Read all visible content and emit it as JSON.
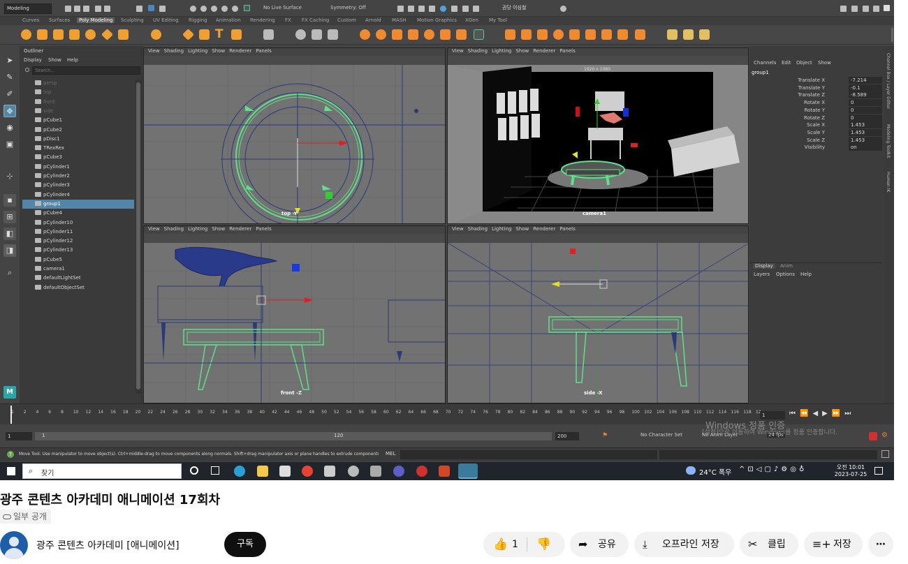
{
  "maya": {
    "menu_set": "Modeling",
    "live_surface": "No Live Surface",
    "symmetry": "Symmetry: Off",
    "user_label": "권당 이심철",
    "shelf_tabs": [
      "Curves",
      "Surfaces",
      "Poly Modeling",
      "Sculpting",
      "UV Editing",
      "Rigging",
      "Animation",
      "Rendering",
      "FX",
      "FX Caching",
      "Custom",
      "Arnold",
      "MASH",
      "Motion Graphics",
      "XGen",
      "My Tool"
    ],
    "active_shelf_tab": "Poly Modeling",
    "outliner": {
      "title": "Outliner",
      "menus": [
        "Display",
        "Show",
        "Help"
      ],
      "search_placeholder": "Search...",
      "items": [
        "persp",
        "top",
        "front",
        "side",
        "pCube1",
        "pCube2",
        "pDisc1",
        "TRexRex",
        "pCube3",
        "pCylinder1",
        "pCylinder2",
        "pCylinder3",
        "pCylinder4",
        "group1",
        "pCube4",
        "pCylinder10",
        "pCylinder11",
        "pCylinder12",
        "pCylinder13",
        "pCube5",
        "camera1",
        "defaultLightSet",
        "defaultObjectSet"
      ],
      "selected_item": "group1"
    },
    "viewport_menus": [
      "View",
      "Shading",
      "Lighting",
      "Show",
      "Renderer",
      "Panels"
    ],
    "viewports": {
      "top": {
        "label": "top -Y"
      },
      "persp": {
        "label": "camera1",
        "resolution": "1920 x 1080"
      },
      "front": {
        "label": "front -Z"
      },
      "side": {
        "label": "side -X"
      }
    },
    "channel_box": {
      "menus": [
        "Channels",
        "Edit",
        "Object",
        "Show"
      ],
      "object": "group1",
      "attributes": [
        {
          "name": "Translate X",
          "value": "-7.214"
        },
        {
          "name": "Translate Y",
          "value": "-0.1"
        },
        {
          "name": "Translate Z",
          "value": "-8.589"
        },
        {
          "name": "Rotate X",
          "value": "0"
        },
        {
          "name": "Rotate Y",
          "value": "0"
        },
        {
          "name": "Rotate Z",
          "value": "0"
        },
        {
          "name": "Scale X",
          "value": "1.453"
        },
        {
          "name": "Scale Y",
          "value": "1.453"
        },
        {
          "name": "Scale Z",
          "value": "1.453"
        },
        {
          "name": "Visibility",
          "value": "on"
        }
      ],
      "layer_tabs": [
        "Display",
        "Anim"
      ],
      "layer_menus": [
        "Layers",
        "Options",
        "Help"
      ]
    },
    "side_tabs": [
      "Channel Box / Layer Editor",
      "Modeling Toolkit",
      "Human IK"
    ],
    "timeline_ticks": [
      "1",
      "2",
      "4",
      "6",
      "8",
      "10",
      "12",
      "14",
      "16",
      "18",
      "20",
      "22",
      "24",
      "26",
      "28",
      "30",
      "32",
      "34",
      "36",
      "38",
      "40",
      "42",
      "44",
      "46",
      "48",
      "50",
      "52",
      "54",
      "56",
      "58",
      "60",
      "62",
      "64",
      "66",
      "68",
      "70",
      "72",
      "74",
      "76",
      "78",
      "80",
      "82",
      "84",
      "86",
      "88",
      "90",
      "92",
      "94",
      "96",
      "98",
      "100",
      "102",
      "104",
      "106",
      "108",
      "110",
      "112",
      "114",
      "116",
      "118",
      "12"
    ],
    "current_frame": "1",
    "range": {
      "start": "1",
      "inner_start": "1",
      "inner_end": "120",
      "end": "200"
    },
    "character_set": "No Character Set",
    "anim_layer": "No Anim Layer",
    "fps": "24 fps",
    "help_line": "Move Tool: Use manipulator to move object(s). Ctrl+middle-drag to move components along normals. Shift+drag manipulator axis or plane handles to extrude components or cli",
    "mel_label": "MEL",
    "watermark": {
      "line1": "Windows 정품 인증",
      "line2": "[설정]으로 이동하여 Windows를 정품 인증합니다."
    }
  },
  "taskbar": {
    "search_placeholder": "찾기",
    "weather": "24°C 폭우",
    "time": "오전 10:01",
    "date": "2023-07-25"
  },
  "video": {
    "title": "광주 콘텐츠 아카데미 애니메이션 17회차",
    "visibility": "일부 공개",
    "channel": "광주 콘텐츠 아카데미 [애니메이션]",
    "subscribe": "구독",
    "likes": "1",
    "share": "공유",
    "download": "오프라인 저장",
    "clip": "클립",
    "save": "저장"
  },
  "colors": {
    "maya_bg": "#444444",
    "viewport_grey": "#727272",
    "selection_blue": "#5285a6",
    "wire_green": "#5fe08a",
    "wire_blue": "#2a3a7a",
    "subscribe_bg": "#0f0f0f"
  }
}
